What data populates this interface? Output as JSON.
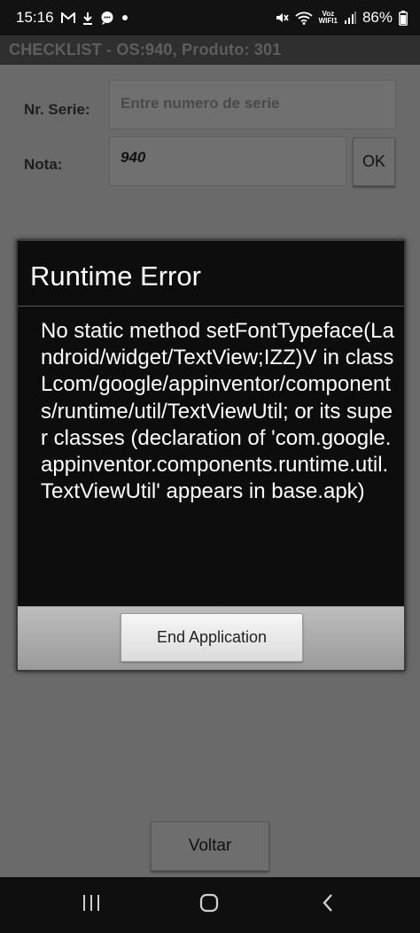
{
  "status_bar": {
    "time": "15:16",
    "voz": "Voz",
    "wifi_label": "WIFI1",
    "battery": "86%",
    "icons": [
      "gmail-icon",
      "download-icon",
      "chat-icon",
      "dot-icon",
      "mute-icon",
      "wifi-icon",
      "signal-icon",
      "battery-icon"
    ]
  },
  "app": {
    "title": "CHECKLIST - OS:940,  Produto: 301"
  },
  "form": {
    "serial_label": "Nr. Serie:",
    "serial_placeholder": "Entre numero de serie",
    "serial_value": "",
    "nota_label": "Nota:",
    "nota_value": "940",
    "ok_label": "OK"
  },
  "dialog": {
    "title": "Runtime Error",
    "message": "No static method setFontTypeface(Landroid/widget/TextView;IZZ)V in class Lcom/google/appinventor/components/runtime/util/TextViewUtil; or its super classes (declaration of 'com.google.appinventor.components.runtime.util.TextViewUtil' appears in base.apk)",
    "end_button": "End Application"
  },
  "bottom": {
    "voltar_label": "Voltar"
  },
  "nav": {
    "items": [
      "recents-icon",
      "home-icon",
      "back-icon"
    ]
  },
  "colors": {
    "background_dim": "#6a6a6a",
    "dialog_bg": "#0d0d0d",
    "status_bar": "#121212"
  }
}
